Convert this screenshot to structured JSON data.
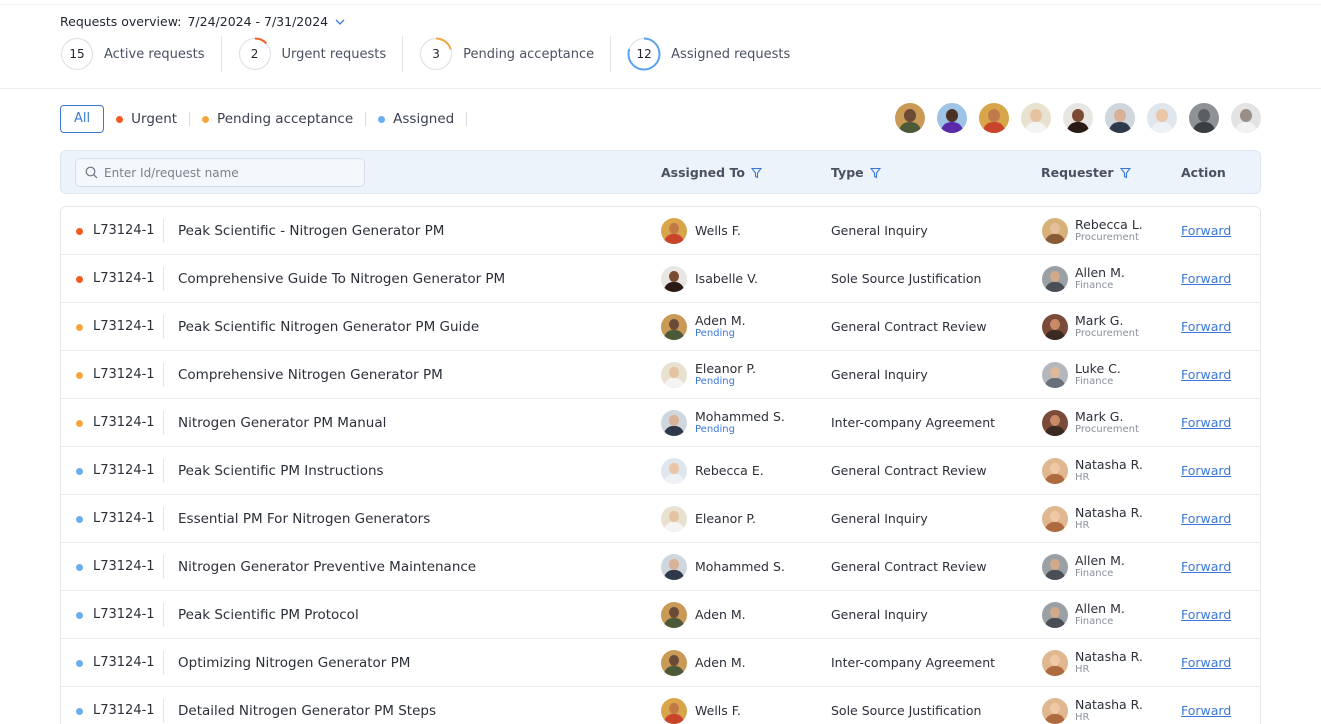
{
  "overview": {
    "label": "Requests overview:",
    "date_range": "7/24/2024 - 7/31/2024",
    "stats": [
      {
        "count": "15",
        "label": "Active requests",
        "ring_color": "#d6dbe3",
        "progress": 0
      },
      {
        "count": "2",
        "label": "Urgent requests",
        "ring_color": "#f25a22",
        "progress": 0.13
      },
      {
        "count": "3",
        "label": "Pending acceptance",
        "ring_color": "#f5a53e",
        "progress": 0.2
      },
      {
        "count": "12",
        "label": "Assigned requests",
        "ring_color": "#5aa2ee",
        "progress": 0.8
      }
    ]
  },
  "filters": {
    "all": "All",
    "chips": [
      {
        "label": "Urgent",
        "color": "#f25a22"
      },
      {
        "label": "Pending acceptance",
        "color": "#f5a53e"
      },
      {
        "label": "Assigned",
        "color": "#6aaef0"
      }
    ]
  },
  "team_avatars": [
    {
      "name": "Aden M.",
      "bg": "#c89a55",
      "skin": "#6b4a36",
      "shirt": "#4c5a3a"
    },
    {
      "name": "Purple avatar",
      "bg": "#9fc3e6",
      "skin": "#4a3124",
      "shirt": "#5a2aa8"
    },
    {
      "name": "Wells F.",
      "bg": "#d9a54a",
      "skin": "#c07a48",
      "shirt": "#c8442a"
    },
    {
      "name": "Eleanor P.",
      "bg": "#e9e1cf",
      "skin": "#e6c2a0",
      "shirt": "#f4f4f2"
    },
    {
      "name": "Isabelle V.",
      "bg": "#e8e6e2",
      "skin": "#7a4a33",
      "shirt": "#2a1a14"
    },
    {
      "name": "Mohammed S.",
      "bg": "#cfd6de",
      "skin": "#d8b196",
      "shirt": "#2e3a4a"
    },
    {
      "name": "Rebecca E.",
      "bg": "#dfe6ee",
      "skin": "#eac5a6",
      "shirt": "#eef2f6"
    },
    {
      "name": "Grey avatar",
      "bg": "#8e9196",
      "skin": "#5b5e62",
      "shirt": "#3a3d42"
    },
    {
      "name": "Light avatar",
      "bg": "#e3e3e3",
      "skin": "#9a8f86",
      "shirt": "#f2f2f2"
    }
  ],
  "table": {
    "search_placeholder": "Enter Id/request name",
    "headers": {
      "assigned_to": "Assigned To",
      "type": "Type",
      "requester": "Requester",
      "action": "Action"
    },
    "rows": [
      {
        "status_color": "#f25a22",
        "id": "L73124-1",
        "name": "Peak Scientific - Nitrogen Generator PM",
        "assignee": "Wells F.",
        "assignee_sub": "",
        "assignee_av": 2,
        "type": "General Inquiry",
        "requester": "Rebecca L.",
        "requester_dept": "Procurement",
        "requester_av": 0,
        "action": "Forward"
      },
      {
        "status_color": "#f25a22",
        "id": "L73124-1",
        "name": "Comprehensive Guide To Nitrogen Generator PM",
        "assignee": "Isabelle V.",
        "assignee_sub": "",
        "assignee_av": 4,
        "type": "Sole Source Justification",
        "requester": "Allen M.",
        "requester_dept": "Finance",
        "requester_av": 1,
        "action": "Forward"
      },
      {
        "status_color": "#f5a53e",
        "id": "L73124-1",
        "name": "Peak Scientific Nitrogen Generator PM Guide",
        "assignee": "Aden M.",
        "assignee_sub": "Pending",
        "assignee_av": 0,
        "type": "General Contract Review",
        "requester": "Mark G.",
        "requester_dept": "Procurement",
        "requester_av": 2,
        "action": "Forward"
      },
      {
        "status_color": "#f5a53e",
        "id": "L73124-1",
        "name": "Comprehensive Nitrogen Generator PM",
        "assignee": "Eleanor P.",
        "assignee_sub": "Pending",
        "assignee_av": 3,
        "type": "General Inquiry",
        "requester": "Luke C.",
        "requester_dept": "Finance",
        "requester_av": 3,
        "action": "Forward"
      },
      {
        "status_color": "#f5a53e",
        "id": "L73124-1",
        "name": "Nitrogen Generator PM Manual",
        "assignee": "Mohammed S.",
        "assignee_sub": "Pending",
        "assignee_av": 5,
        "type": "Inter-company Agreement",
        "requester": "Mark G.",
        "requester_dept": "Procurement",
        "requester_av": 2,
        "action": "Forward"
      },
      {
        "status_color": "#6aaef0",
        "id": "L73124-1",
        "name": "Peak Scientific PM Instructions",
        "assignee": "Rebecca E.",
        "assignee_sub": "",
        "assignee_av": 6,
        "type": "General Contract Review",
        "requester": "Natasha R.",
        "requester_dept": "HR",
        "requester_av": 4,
        "action": "Forward"
      },
      {
        "status_color": "#6aaef0",
        "id": "L73124-1",
        "name": "Essential PM For Nitrogen Generators",
        "assignee": "Eleanor P.",
        "assignee_sub": "",
        "assignee_av": 3,
        "type": "General Inquiry",
        "requester": "Natasha R.",
        "requester_dept": "HR",
        "requester_av": 4,
        "action": "Forward"
      },
      {
        "status_color": "#6aaef0",
        "id": "L73124-1",
        "name": "Nitrogen Generator Preventive Maintenance",
        "assignee": "Mohammed S.",
        "assignee_sub": "",
        "assignee_av": 5,
        "type": "General Contract Review",
        "requester": "Allen M.",
        "requester_dept": "Finance",
        "requester_av": 1,
        "action": "Forward"
      },
      {
        "status_color": "#6aaef0",
        "id": "L73124-1",
        "name": "Peak Scientific PM Protocol",
        "assignee": "Aden M.",
        "assignee_sub": "",
        "assignee_av": 0,
        "type": "General Inquiry",
        "requester": "Allen M.",
        "requester_dept": "Finance",
        "requester_av": 1,
        "action": "Forward"
      },
      {
        "status_color": "#6aaef0",
        "id": "L73124-1",
        "name": "Optimizing Nitrogen Generator PM",
        "assignee": "Aden M.",
        "assignee_sub": "",
        "assignee_av": 0,
        "type": "Inter-company Agreement",
        "requester": "Natasha R.",
        "requester_dept": "HR",
        "requester_av": 4,
        "action": "Forward"
      },
      {
        "status_color": "#6aaef0",
        "id": "L73124-1",
        "name": "Detailed Nitrogen Generator PM Steps",
        "assignee": "Wells F.",
        "assignee_sub": "",
        "assignee_av": 2,
        "type": "Sole Source Justification",
        "requester": "Natasha R.",
        "requester_dept": "HR",
        "requester_av": 4,
        "action": "Forward"
      }
    ]
  },
  "requester_avatars": [
    {
      "bg": "#d8b07a",
      "skin": "#e6c09c",
      "shirt": "#8a5a38"
    },
    {
      "bg": "#9aa0a6",
      "skin": "#d0a88a",
      "shirt": "#4a4f56"
    },
    {
      "bg": "#7a4a3a",
      "skin": "#c88a66",
      "shirt": "#3a2a22"
    },
    {
      "bg": "#b4b8bd",
      "skin": "#e0b89a",
      "shirt": "#6a707a"
    },
    {
      "bg": "#e0b890",
      "skin": "#f0c8a4",
      "shirt": "#b06a40"
    }
  ]
}
